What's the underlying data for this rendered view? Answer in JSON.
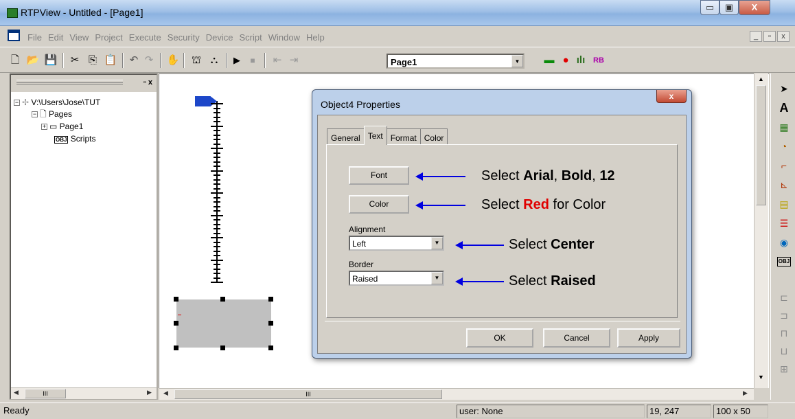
{
  "window": {
    "title": "RTPView  -  Untitled - [Page1]",
    "min": "▭",
    "max": "▣",
    "close": "X"
  },
  "menu": [
    "File",
    "Edit",
    "View",
    "Project",
    "Execute",
    "Security",
    "Device",
    "Script",
    "Window",
    "Help"
  ],
  "mdi": {
    "min": "_",
    "restore": "▫",
    "close": "x"
  },
  "toolbar": {
    "page_combo": "Page1"
  },
  "tree": {
    "root": "V:\\Users\\Jose\\TUT",
    "pages": "Pages",
    "page1": "Page1",
    "scripts": "Scripts"
  },
  "leftpane": {
    "scroll_thumb": "III"
  },
  "canvas": {
    "scroll_thumb": "III"
  },
  "dialog": {
    "title": "Object4 Properties",
    "close": "x",
    "tabs": [
      "General",
      "Text",
      "Format",
      "Color"
    ],
    "font_button": "Font",
    "color_button": "Color",
    "alignment_label": "Alignment",
    "alignment_value": "Left",
    "border_label": "Border",
    "border_value": "Raised",
    "ok": "OK",
    "cancel": "Cancel",
    "apply": "Apply"
  },
  "annotations": {
    "font": {
      "pre": "Select ",
      "a": "Arial",
      "sep1": ", ",
      "b": "Bold",
      "sep2": ", ",
      "c": "12"
    },
    "color": {
      "pre": "Select ",
      "red": "Red",
      "post": " for Color"
    },
    "align": {
      "pre": "Select ",
      "b": "Center"
    },
    "border": {
      "pre": "Select ",
      "b": "Raised"
    }
  },
  "status": {
    "ready": "Ready",
    "user": "user: None",
    "coords": "19, 247",
    "size": "100 x 50"
  }
}
